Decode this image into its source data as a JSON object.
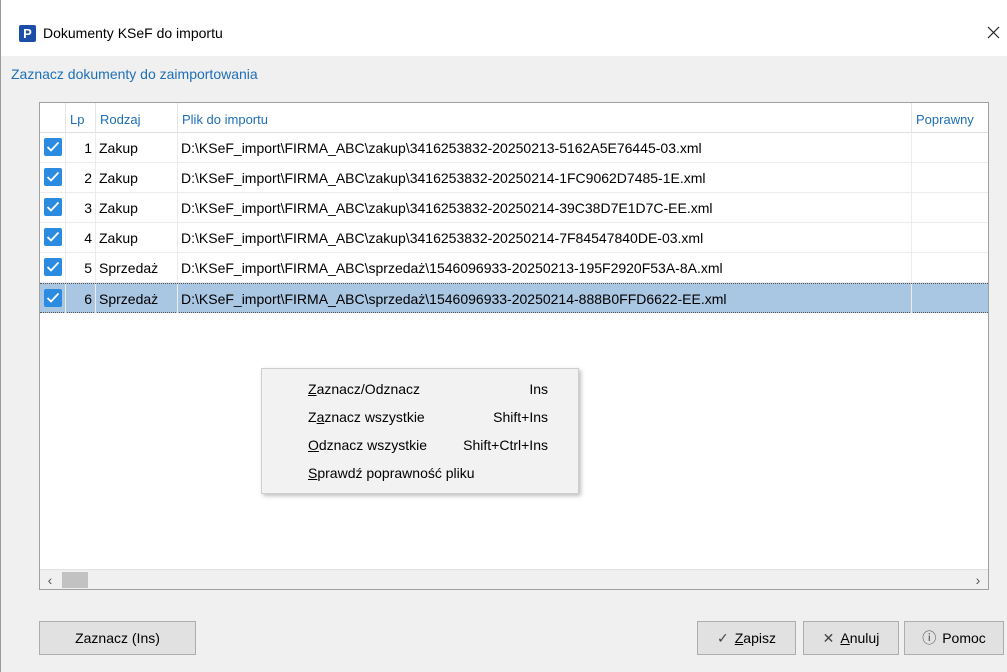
{
  "window": {
    "app_icon": "P",
    "title": "Dokumenty KSeF do importu",
    "close_icon": "close-icon"
  },
  "subtitle": "Zaznacz dokumenty do zaimportowania",
  "table": {
    "headers": {
      "lp": "Lp",
      "rodzaj": "Rodzaj",
      "plik": "Plik do importu",
      "poprawny": "Poprawny"
    },
    "rows": [
      {
        "checked": true,
        "lp": "1",
        "rodzaj": "Zakup",
        "plik": "D:\\KSeF_import\\FIRMA_ABC\\zakup\\3416253832-20250213-5162A5E76445-03.xml"
      },
      {
        "checked": true,
        "lp": "2",
        "rodzaj": "Zakup",
        "plik": "D:\\KSeF_import\\FIRMA_ABC\\zakup\\3416253832-20250214-1FC9062D7485-1E.xml"
      },
      {
        "checked": true,
        "lp": "3",
        "rodzaj": "Zakup",
        "plik": "D:\\KSeF_import\\FIRMA_ABC\\zakup\\3416253832-20250214-39C38D7E1D7C-EE.xml"
      },
      {
        "checked": true,
        "lp": "4",
        "rodzaj": "Zakup",
        "plik": "D:\\KSeF_import\\FIRMA_ABC\\zakup\\3416253832-20250214-7F84547840DE-03.xml"
      },
      {
        "checked": true,
        "lp": "5",
        "rodzaj": "Sprzedaż",
        "plik": "D:\\KSeF_import\\FIRMA_ABC\\sprzedaż\\1546096933-20250213-195F2920F53A-8A.xml"
      },
      {
        "checked": true,
        "lp": "6",
        "rodzaj": "Sprzedaż",
        "plik": "D:\\KSeF_import\\FIRMA_ABC\\sprzedaż\\1546096933-20250214-888B0FFD6622-EE.xml",
        "selected": true
      }
    ]
  },
  "context_menu": {
    "items": [
      {
        "label": "Zaznacz/Odznacz",
        "shortcut": "Ins",
        "mnemonic_index": 0
      },
      {
        "label": "Zaznacz wszystkie",
        "shortcut": "Shift+Ins",
        "mnemonic_index": 1
      },
      {
        "label": "Odznacz wszystkie",
        "shortcut": "Shift+Ctrl+Ins",
        "mnemonic_index": 0
      },
      {
        "label": "Sprawdź poprawność pliku",
        "shortcut": "",
        "mnemonic_index": 0
      }
    ]
  },
  "buttons": {
    "toggle": "Zaznacz (Ins)",
    "save": "Zapisz",
    "cancel": "Anuluj",
    "help": "Pomoc"
  },
  "colors": {
    "accent": "#1e6fb8",
    "checkbox": "#2b8be0",
    "selected_row": "#a9c6e2",
    "app_icon": "#1a4ea8"
  }
}
